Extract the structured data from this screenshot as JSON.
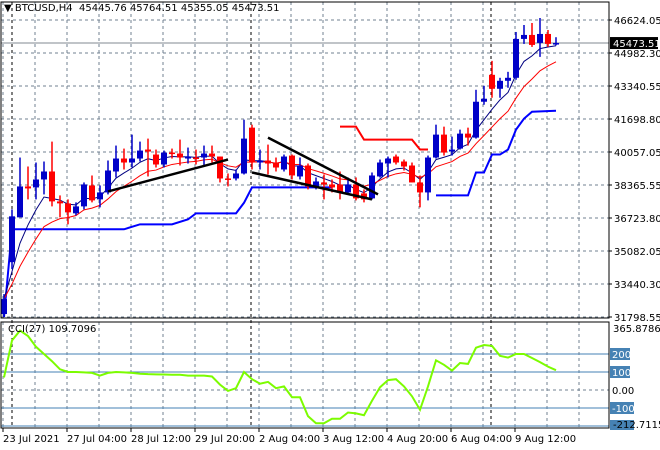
{
  "header": {
    "symbol": "BTCUSD,H4",
    "open": "45445.76",
    "high": "45764.51",
    "low": "45355.05",
    "close": "45473.51"
  },
  "cci_label": {
    "name": "CCI(27)",
    "value": "109.7096"
  },
  "colors": {
    "bull": "#0000c8",
    "bear": "#ff0000",
    "ema_fast": "#000080",
    "ema_slow": "#ff0000",
    "stop_lower": "#0000ff",
    "stop_upper": "#ff0000",
    "trendline": "#000000",
    "cci": "#7cfc00",
    "cci_levels": "#4682b4",
    "grid": "#708090"
  },
  "price_axis": {
    "labels": [
      "46624.05",
      "44982.30",
      "43340.55",
      "41698.80",
      "40057.05",
      "38365.55",
      "36723.80",
      "35082.05",
      "33440.30",
      "31798.55"
    ],
    "current_price": "45473.51"
  },
  "cci_axis": {
    "max": "365.8786",
    "min": "-212.7115",
    "levels": [
      "200",
      "100",
      "0.00",
      "-100"
    ]
  },
  "time_axis": [
    "23 Jul 2021",
    "27 Jul 04:00",
    "28 Jul 12:00",
    "29 Jul 20:00",
    "2 Aug 04:00",
    "3 Aug 12:00",
    "4 Aug 20:00",
    "6 Aug 04:00",
    "9 Aug 12:00"
  ],
  "chart_data": {
    "type": "candlestick",
    "symbol": "BTCUSD",
    "timeframe": "H4",
    "ylim": [
      31798.55,
      47520
    ],
    "candles_ohlc": [
      [
        31948,
        32943,
        31799,
        32694
      ],
      [
        34535,
        37171,
        34187,
        36823
      ],
      [
        36773,
        39759,
        37420,
        38316
      ],
      [
        38316,
        39311,
        37669,
        38216
      ],
      [
        38266,
        39510,
        37669,
        38664
      ],
      [
        38664,
        39560,
        37918,
        39062
      ],
      [
        39062,
        40554,
        37320,
        37570
      ],
      [
        37570,
        37868,
        36773,
        37470
      ],
      [
        37470,
        37669,
        36424,
        37022
      ],
      [
        36972,
        37520,
        36873,
        37320
      ],
      [
        37320,
        38515,
        37171,
        38416
      ],
      [
        38366,
        38863,
        37520,
        37619
      ],
      [
        37669,
        38366,
        37271,
        38017
      ],
      [
        38017,
        39610,
        37918,
        39112
      ],
      [
        39062,
        40356,
        38764,
        39709
      ],
      [
        39709,
        40206,
        39162,
        39510
      ],
      [
        39510,
        40903,
        39261,
        39709
      ],
      [
        39709,
        40554,
        39560,
        40107
      ],
      [
        40157,
        40704,
        38814,
        40057
      ],
      [
        39908,
        40157,
        39261,
        39411
      ],
      [
        39411,
        40107,
        39261,
        40007
      ],
      [
        40007,
        40206,
        39709,
        39958
      ],
      [
        39958,
        40654,
        39361,
        39759
      ],
      [
        39709,
        40256,
        39460,
        39809
      ],
      [
        39759,
        40157,
        39411,
        39709
      ],
      [
        39759,
        40356,
        39361,
        39958
      ],
      [
        39958,
        40356,
        39510,
        39809
      ],
      [
        39809,
        39809,
        38515,
        38714
      ],
      [
        38714,
        38963,
        38316,
        38664
      ],
      [
        38714,
        39162,
        38615,
        38963
      ],
      [
        38963,
        41649,
        38913,
        40704
      ],
      [
        41251,
        41400,
        39162,
        39510
      ],
      [
        39510,
        40157,
        39162,
        39610
      ],
      [
        39610,
        40405,
        38913,
        39460
      ],
      [
        39510,
        39759,
        39062,
        39261
      ],
      [
        39162,
        39908,
        39062,
        39809
      ],
      [
        39858,
        39908,
        38664,
        38863
      ],
      [
        38814,
        39759,
        38664,
        39361
      ],
      [
        39361,
        39460,
        38167,
        38316
      ],
      [
        38266,
        38764,
        38167,
        38565
      ],
      [
        38515,
        38913,
        37669,
        38416
      ],
      [
        38416,
        38664,
        38017,
        38266
      ],
      [
        38416,
        39062,
        37669,
        38017
      ],
      [
        38017,
        38764,
        37918,
        38416
      ],
      [
        38416,
        38764,
        37619,
        37719
      ],
      [
        37968,
        38167,
        37520,
        37669
      ],
      [
        37719,
        39013,
        37669,
        38863
      ],
      [
        38814,
        39659,
        38764,
        39510
      ],
      [
        39460,
        39809,
        38764,
        39709
      ],
      [
        39809,
        39908,
        39411,
        39510
      ],
      [
        39560,
        39659,
        39112,
        39311
      ],
      [
        39361,
        39510,
        38515,
        38515
      ],
      [
        38515,
        38863,
        37271,
        38017
      ],
      [
        38017,
        39858,
        37619,
        39759
      ],
      [
        39759,
        41400,
        39709,
        40903
      ],
      [
        40903,
        41301,
        39858,
        40007
      ],
      [
        40057,
        40803,
        39858,
        40157
      ],
      [
        40206,
        41152,
        40157,
        40952
      ],
      [
        40952,
        41251,
        40356,
        40754
      ],
      [
        40754,
        43141,
        40704,
        42544
      ],
      [
        42544,
        43340,
        42395,
        42694
      ],
      [
        43888,
        44584,
        42743,
        43191
      ],
      [
        43191,
        43739,
        42743,
        43589
      ],
      [
        43589,
        44037,
        43241,
        43739
      ],
      [
        43739,
        46027,
        43639,
        45679
      ],
      [
        45679,
        46375,
        45430,
        45878
      ],
      [
        45878,
        46475,
        45281,
        45380
      ],
      [
        45480,
        46724,
        44783,
        45927
      ],
      [
        45927,
        46126,
        45281,
        45430
      ],
      [
        45445.76,
        45764.51,
        45355.05,
        45473.51
      ]
    ],
    "ema_periods": [
      5,
      10
    ],
    "stop_lower_1": [
      [
        0,
        31799
      ],
      [
        1,
        36177
      ],
      [
        15,
        36177
      ],
      [
        17,
        36424
      ],
      [
        21,
        36424
      ],
      [
        23,
        36672
      ],
      [
        24,
        36972
      ],
      [
        29,
        36972
      ],
      [
        30,
        37500
      ],
      [
        31,
        38266
      ],
      [
        41,
        38266
      ]
    ],
    "stop_upper": [
      [
        42,
        41301
      ],
      [
        44,
        41301
      ],
      [
        45,
        40654
      ],
      [
        51,
        40654
      ],
      [
        52,
        40157
      ],
      [
        53,
        40157
      ]
    ],
    "stop_lower_2": [
      [
        54,
        37868
      ],
      [
        58,
        37868
      ],
      [
        59,
        39013
      ],
      [
        60,
        39013
      ],
      [
        61,
        39908
      ],
      [
        62,
        39908
      ],
      [
        63,
        40157
      ],
      [
        64,
        41152
      ],
      [
        65,
        41700
      ],
      [
        66,
        42047
      ],
      [
        69,
        42097
      ]
    ],
    "trendlines": [
      [
        [
          13,
          38067
        ],
        [
          28,
          39659
        ]
      ],
      [
        [
          31,
          39013
        ],
        [
          46,
          37669
        ]
      ],
      [
        [
          33,
          40754
        ],
        [
          46.75,
          37918
        ]
      ]
    ],
    "cci": [
      70,
      275,
      330,
      300,
      240,
      200,
      160,
      115,
      100,
      100,
      98,
      95,
      80,
      95,
      100,
      98,
      95,
      90,
      88,
      87,
      86,
      85,
      85,
      80,
      80,
      80,
      75,
      30,
      -5,
      10,
      100,
      60,
      35,
      45,
      10,
      20,
      -40,
      -40,
      -145,
      -185,
      -185,
      -160,
      -160,
      -125,
      -130,
      -140,
      -60,
      15,
      55,
      60,
      20,
      -35,
      -110,
      20,
      165,
      140,
      108,
      150,
      145,
      235,
      250,
      245,
      190,
      180,
      200,
      200,
      178,
      155,
      130,
      110
    ],
    "cci_ylim": [
      -212.7115,
      365.8786
    ],
    "cci_levels": [
      200,
      100,
      0,
      -100,
      -200
    ]
  }
}
